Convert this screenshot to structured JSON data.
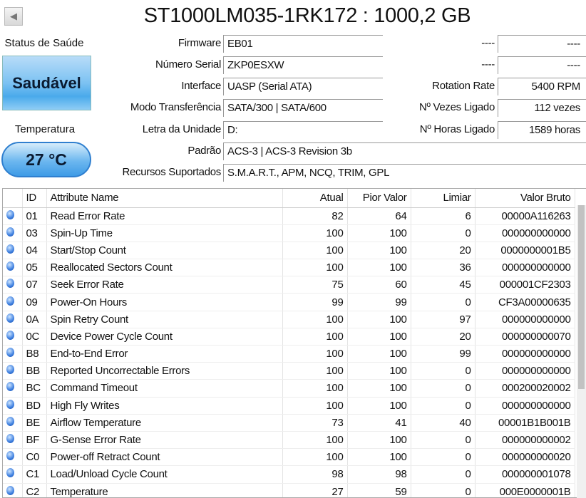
{
  "title": "ST1000LM035-1RK172 : 1000,2 GB",
  "health": {
    "label": "Status de Saúde",
    "value": "Saudável",
    "color": "#4aaaeb"
  },
  "temperature": {
    "label": "Temperatura",
    "value": "27 °C"
  },
  "info": {
    "firmware": {
      "label": "Firmware",
      "value": "EB01"
    },
    "serial": {
      "label": "Número Serial",
      "value": "ZKP0ESXW"
    },
    "interface": {
      "label": "Interface",
      "value": "UASP (Serial ATA)"
    },
    "transfer": {
      "label": "Modo Transferência",
      "value": "SATA/300 | SATA/600"
    },
    "drive": {
      "label": "Letra da Unidade",
      "value": "D:"
    },
    "standard": {
      "label": "Padrão",
      "value": "ACS-3 | ACS-3 Revision 3b"
    },
    "features": {
      "label": "Recursos Suportados",
      "value": "S.M.A.R.T., APM, NCQ, TRIM, GPL"
    },
    "r1": {
      "label": "----",
      "value": "----"
    },
    "r2": {
      "label": "----",
      "value": "----"
    },
    "rotation": {
      "label": "Rotation Rate",
      "value": "5400 RPM"
    },
    "powercount": {
      "label": "Nº Vezes Ligado",
      "value": "112 vezes"
    },
    "powerhours": {
      "label": "Nº Horas Ligado",
      "value": "1589 horas"
    }
  },
  "columns": [
    "ID",
    "Attribute Name",
    "Atual",
    "Pior Valor",
    "Limiar",
    "Valor Bruto"
  ],
  "rows": [
    [
      "01",
      "Read Error Rate",
      "82",
      "64",
      "6",
      "00000A116263"
    ],
    [
      "03",
      "Spin-Up Time",
      "100",
      "100",
      "0",
      "000000000000"
    ],
    [
      "04",
      "Start/Stop Count",
      "100",
      "100",
      "20",
      "0000000001B5"
    ],
    [
      "05",
      "Reallocated Sectors Count",
      "100",
      "100",
      "36",
      "000000000000"
    ],
    [
      "07",
      "Seek Error Rate",
      "75",
      "60",
      "45",
      "000001CF2303"
    ],
    [
      "09",
      "Power-On Hours",
      "99",
      "99",
      "0",
      "CF3A00000635"
    ],
    [
      "0A",
      "Spin Retry Count",
      "100",
      "100",
      "97",
      "000000000000"
    ],
    [
      "0C",
      "Device Power Cycle Count",
      "100",
      "100",
      "20",
      "000000000070"
    ],
    [
      "B8",
      "End-to-End Error",
      "100",
      "100",
      "99",
      "000000000000"
    ],
    [
      "BB",
      "Reported Uncorrectable Errors",
      "100",
      "100",
      "0",
      "000000000000"
    ],
    [
      "BC",
      "Command Timeout",
      "100",
      "100",
      "0",
      "000200020002"
    ],
    [
      "BD",
      "High Fly Writes",
      "100",
      "100",
      "0",
      "000000000000"
    ],
    [
      "BE",
      "Airflow Temperature",
      "73",
      "41",
      "40",
      "00001B1B001B"
    ],
    [
      "BF",
      "G-Sense Error Rate",
      "100",
      "100",
      "0",
      "000000000002"
    ],
    [
      "C0",
      "Power-off Retract Count",
      "100",
      "100",
      "0",
      "000000000020"
    ],
    [
      "C1",
      "Load/Unload Cycle Count",
      "98",
      "98",
      "0",
      "000000001078"
    ],
    [
      "C2",
      "Temperature",
      "27",
      "59",
      "0",
      "000E0000001B"
    ]
  ]
}
